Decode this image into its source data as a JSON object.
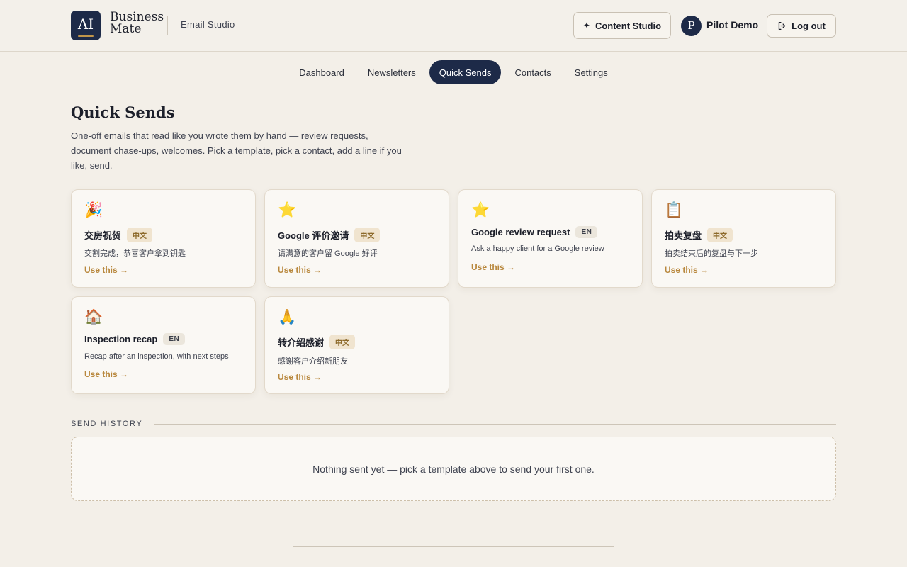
{
  "header": {
    "logo_mark": "AI",
    "logo_line1": "Business",
    "logo_line2": "Mate",
    "app_name": "Email Studio",
    "content_studio_label": "Content Studio",
    "user_initial": "P",
    "user_name": "Pilot Demo",
    "logout_label": "Log out"
  },
  "nav": {
    "items": [
      {
        "label": "Dashboard",
        "active": false
      },
      {
        "label": "Newsletters",
        "active": false
      },
      {
        "label": "Quick Sends",
        "active": true
      },
      {
        "label": "Contacts",
        "active": false
      },
      {
        "label": "Settings",
        "active": false
      }
    ]
  },
  "page": {
    "title": "Quick Sends",
    "description": "One-off emails that read like you wrote them by hand — review requests, document chase-ups, welcomes. Pick a template, pick a contact, add a line if you like, send."
  },
  "templates": [
    {
      "emoji": "🎉",
      "title": "交房祝贺",
      "lang": "中文",
      "desc": "交割完成，恭喜客户拿到钥匙",
      "action": "Use this →"
    },
    {
      "emoji": "⭐",
      "title": "Google 评价邀请",
      "lang": "中文",
      "desc": "请满意的客户留 Google 好评",
      "action": "Use this →"
    },
    {
      "emoji": "⭐",
      "title": "Google review request",
      "lang": "EN",
      "desc": "Ask a happy client for a Google review",
      "action": "Use this →"
    },
    {
      "emoji": "📋",
      "title": "拍卖复盘",
      "lang": "中文",
      "desc": "拍卖结束后的复盘与下一步",
      "action": "Use this →"
    },
    {
      "emoji": "🏠",
      "title": "Inspection recap",
      "lang": "EN",
      "desc": "Recap after an inspection, with next steps",
      "action": "Use this →"
    },
    {
      "emoji": "🙏",
      "title": "转介绍感谢",
      "lang": "中文",
      "desc": "感谢客户介绍新朋友",
      "action": "Use this →"
    }
  ],
  "history": {
    "label": "SEND HISTORY",
    "empty_text": "Nothing sent yet — pick a template above to send your first one."
  },
  "colors": {
    "navy": "#1d2a48",
    "gold": "#b8873c",
    "background": "#f3efe8"
  }
}
